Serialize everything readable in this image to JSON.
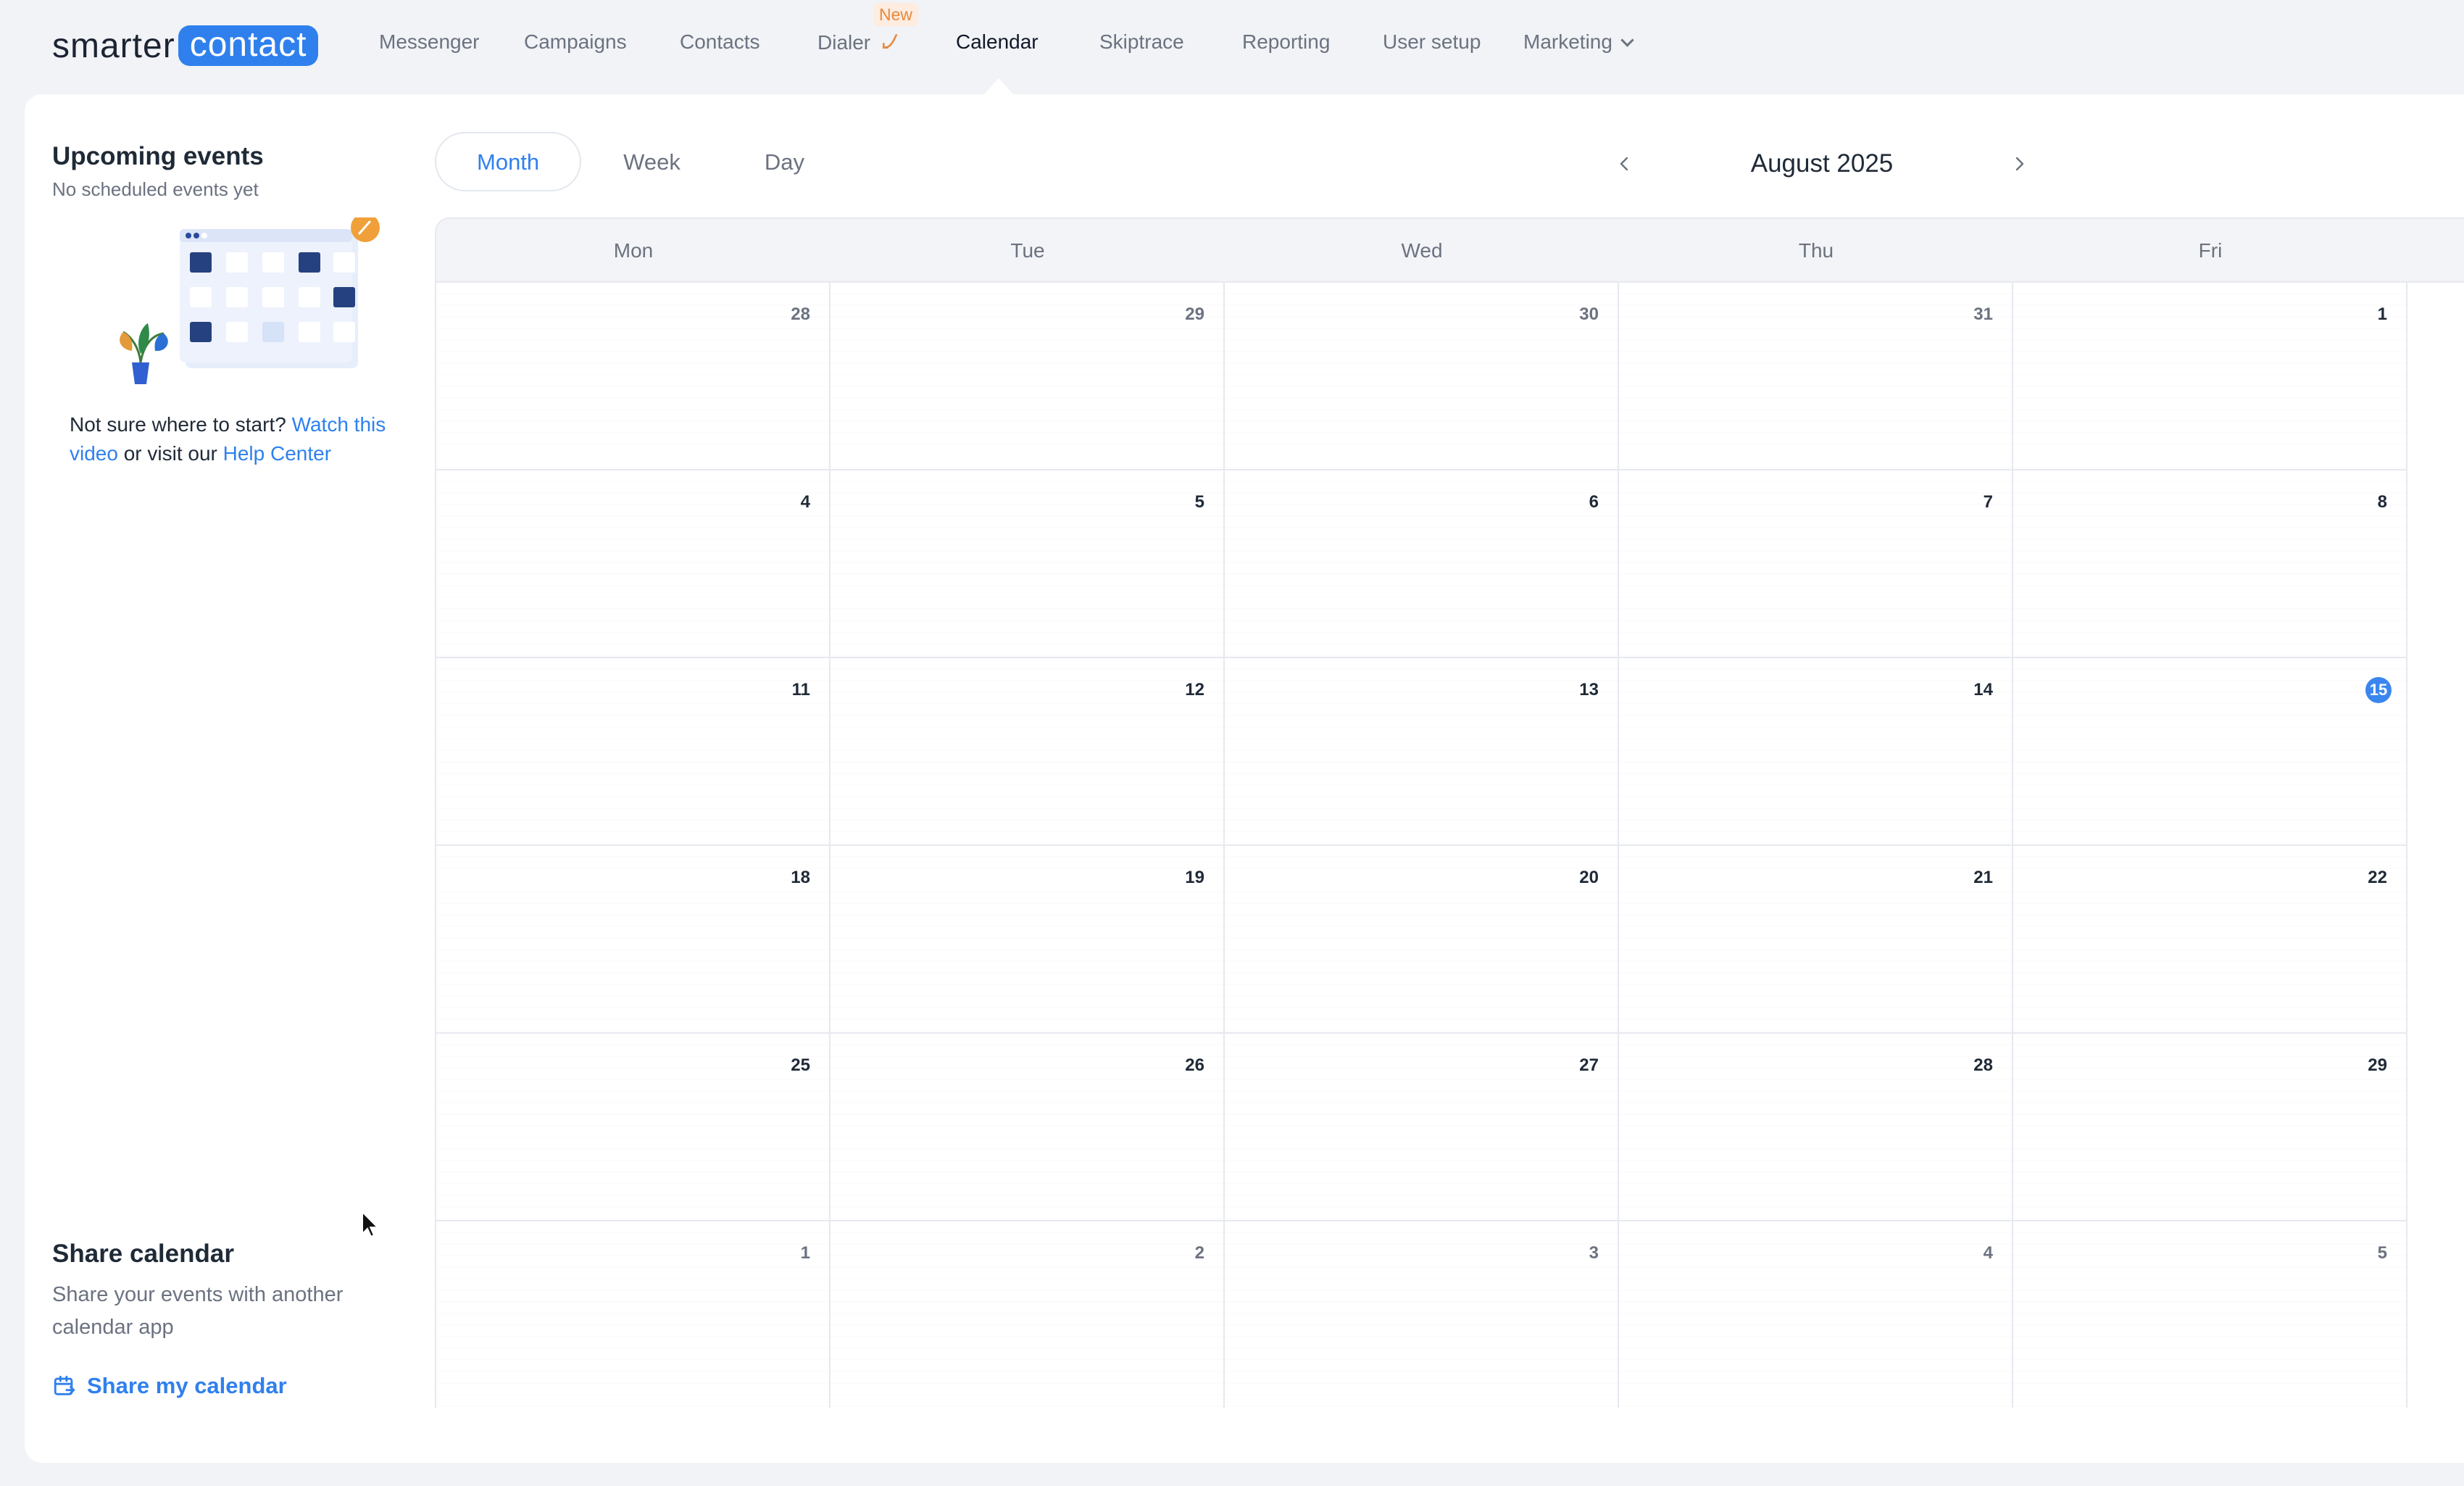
{
  "brand": {
    "part1": "smarter",
    "part2": "contact"
  },
  "nav": {
    "items": [
      "Messenger",
      "Campaigns",
      "Contacts",
      "Dialer",
      "Calendar",
      "Skiptrace",
      "Reporting",
      "User setup",
      "Marketing"
    ],
    "new_badge": "New",
    "active": "Calendar"
  },
  "upcoming": {
    "title": "Upcoming events",
    "subtitle": "No scheduled events yet"
  },
  "help": {
    "prefix": "Not sure where to start? ",
    "link1": "Watch this video",
    "middle": " or visit our ",
    "link2": "Help Center"
  },
  "share": {
    "title": "Share calendar",
    "subtitle": "Share your events with another calendar app",
    "button": "Share my calendar"
  },
  "views": {
    "month": "Month",
    "week": "Week",
    "day": "Day",
    "active": "Month"
  },
  "calendar": {
    "title": "August 2025",
    "weekdays": [
      "Mon",
      "Tue",
      "Wed",
      "Thu",
      "Fri"
    ],
    "weeks": [
      [
        "28",
        "29",
        "30",
        "31",
        "1"
      ],
      [
        "4",
        "5",
        "6",
        "7",
        "8"
      ],
      [
        "11",
        "12",
        "13",
        "14",
        "15"
      ],
      [
        "18",
        "19",
        "20",
        "21",
        "22"
      ],
      [
        "25",
        "26",
        "27",
        "28",
        "29"
      ],
      [
        "1",
        "2",
        "3",
        "4",
        "5"
      ]
    ],
    "muted_weeks": [
      0,
      5
    ],
    "muted_first_week_cols": [
      0,
      1,
      2,
      3
    ],
    "today": "15"
  },
  "colors": {
    "accent": "#2f80ed",
    "today": "#3a86ee",
    "badge": "#e7893d"
  }
}
